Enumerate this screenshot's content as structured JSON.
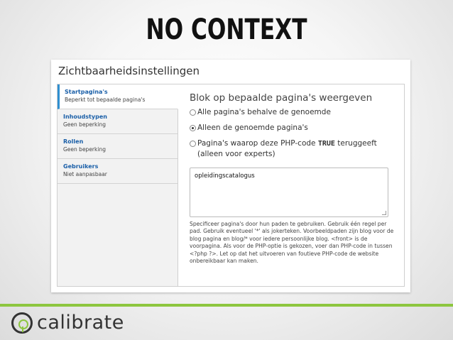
{
  "slide": {
    "title": "NO CONTEXT"
  },
  "section": {
    "title": "Zichtbaarheidsinstellingen"
  },
  "tabs": [
    {
      "name": "Startpagina's",
      "summary": "Beperkt tot bepaalde pagina's"
    },
    {
      "name": "Inhoudstypen",
      "summary": "Geen beperking"
    },
    {
      "name": "Rollen",
      "summary": "Geen beperking"
    },
    {
      "name": "Gebruikers",
      "summary": "Niet aanpasbaar"
    }
  ],
  "pane": {
    "title": "Blok op bepaalde pagina's weergeven",
    "options": [
      {
        "label": "Alle pagina's behalve de genoemde",
        "selected": false
      },
      {
        "label": "Alleen de genoemde pagina's",
        "selected": true
      },
      {
        "label_before": "Pagina's waarop deze PHP-code ",
        "code": "TRUE",
        "label_after": " teruggeeft (alleen voor experts)",
        "selected": false
      }
    ],
    "textarea_value": "opleidingscatalogus",
    "help_text": "Specificeer pagina's door hun paden te gebruiken. Gebruik één regel per pad. Gebruik eventueel '*' als jokerteken. Voorbeeldpaden zijn blog voor de blog pagina en blog/* voor iedere persoonlijke blog. <front> is de voorpagina. Als voor de PHP-optie is gekozen, voer dan PHP-code in tussen <?php ?>. Let op dat het uitvoeren van foutieve PHP-code de website onbereikbaar kan maken."
  },
  "branding": {
    "logo_text": "calibrate",
    "accent_color": "#8dc63f",
    "link_color": "#1a5fa8"
  }
}
